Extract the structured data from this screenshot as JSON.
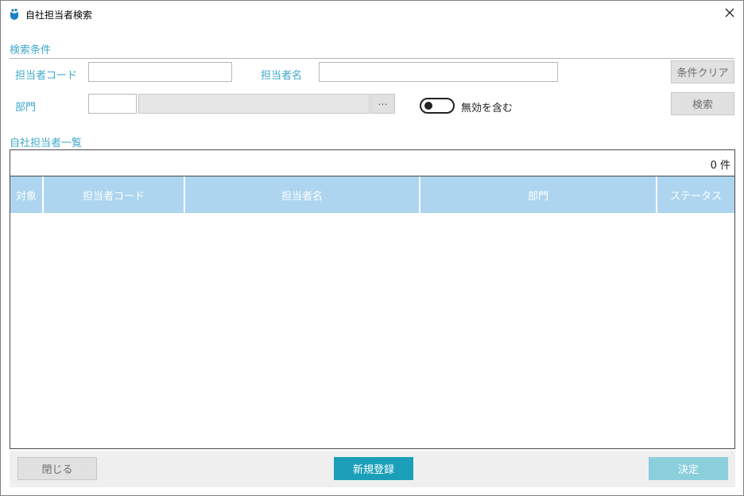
{
  "window": {
    "title": "自社担当者検索"
  },
  "search": {
    "section_title": "検索条件",
    "code_label": "担当者コード",
    "code_value": "",
    "name_label": "担当者名",
    "name_value": "",
    "clear_label": "条件クリア",
    "dept_label": "部門",
    "dept_code_value": "",
    "dept_name_value": "",
    "dept_browse_label": "⋯",
    "include_inactive_label": "無効を含む",
    "include_inactive_on": false,
    "search_label": "検索"
  },
  "list": {
    "section_title": "自社担当者一覧",
    "count": "0 件",
    "columns": [
      "対象",
      "担当者コード",
      "担当者名",
      "部門",
      "ステータス"
    ],
    "rows": []
  },
  "footer": {
    "close_label": "閉じる",
    "new_label": "新規登録",
    "decide_label": "決定"
  },
  "colors": {
    "accent": "#3fa8c8",
    "header_bg": "#add5ef",
    "primary_button": "#1b9fb9",
    "decide_button": "#8ccfdc"
  }
}
